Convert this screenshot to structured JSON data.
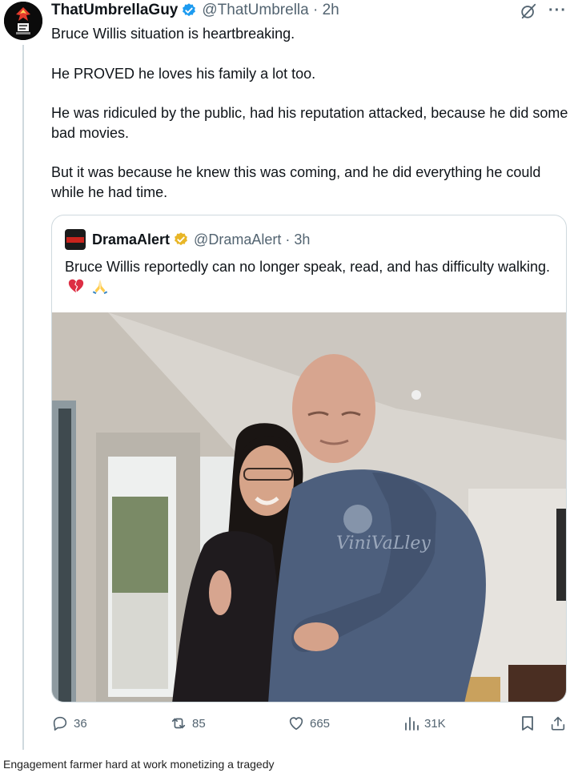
{
  "tweet": {
    "display_name": "ThatUmbrellaGuy",
    "handle_time": "@ThatUmbrella · 2h",
    "paragraphs": [
      "Bruce Willis situation is heartbreaking.",
      "He PROVED he loves his family a lot too.",
      "He was ridiculed by the public, had his reputation attacked, because he did some bad movies.",
      "But it was because he knew this was coming, and he did everything he could while he had time."
    ],
    "icons": {
      "verified": "verified-badge-icon",
      "grok": "grok-icon",
      "more": "more-icon"
    },
    "more_label": "···"
  },
  "quote": {
    "display_name": "DramaAlert",
    "handle_time": "@DramaAlert · 3h",
    "text": "Bruce Willis reportedly can no longer speak, read, and has difficulty walking.",
    "emojis": [
      "broken-heart",
      "folded-hands"
    ],
    "photo_shirt_text": "ViniVaLley"
  },
  "actions": {
    "replies": "36",
    "reposts": "85",
    "likes": "665",
    "views": "31K"
  },
  "caption": "Engagement farmer hard at work monetizing a tragedy",
  "colors": {
    "text": "#0f1419",
    "secondary": "#536471",
    "verified": "#1d9bf0",
    "gold_verified": "#e8b627",
    "border": "#cfd9de"
  }
}
